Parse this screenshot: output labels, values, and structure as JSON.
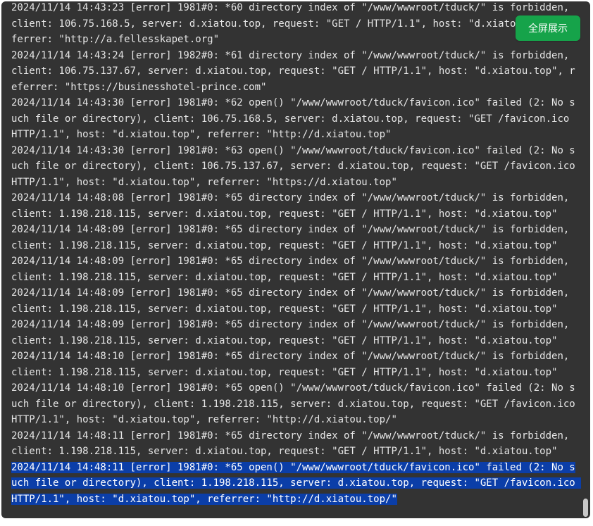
{
  "toolbar": {
    "fullscreen_label": "全屏展示"
  },
  "log": {
    "entries": [
      "2024/11/14 14:43:23 [error] 1981#0: *60 directory index of \"/www/wwwroot/tduck/\" is forbidden, client: 106.75.168.5, server: d.xiatou.top, request: \"GET / HTTP/1.1\", host: \"d.xiatou.top\", referrer: \"http://a.fellesskapet.org\"",
      "2024/11/14 14:43:24 [error] 1982#0: *61 directory index of \"/www/wwwroot/tduck/\" is forbidden, client: 106.75.137.67, server: d.xiatou.top, request: \"GET / HTTP/1.1\", host: \"d.xiatou.top\", referrer: \"https://businesshotel-prince.com\"",
      "2024/11/14 14:43:30 [error] 1981#0: *62 open() \"/www/wwwroot/tduck/favicon.ico\" failed (2: No such file or directory), client: 106.75.168.5, server: d.xiatou.top, request: \"GET /favicon.ico HTTP/1.1\", host: \"d.xiatou.top\", referrer: \"http://d.xiatou.top\"",
      "2024/11/14 14:43:30 [error] 1981#0: *63 open() \"/www/wwwroot/tduck/favicon.ico\" failed (2: No such file or directory), client: 106.75.137.67, server: d.xiatou.top, request: \"GET /favicon.ico HTTP/1.1\", host: \"d.xiatou.top\", referrer: \"https://d.xiatou.top\"",
      "2024/11/14 14:48:08 [error] 1981#0: *65 directory index of \"/www/wwwroot/tduck/\" is forbidden, client: 1.198.218.115, server: d.xiatou.top, request: \"GET / HTTP/1.1\", host: \"d.xiatou.top\"",
      "2024/11/14 14:48:09 [error] 1981#0: *65 directory index of \"/www/wwwroot/tduck/\" is forbidden, client: 1.198.218.115, server: d.xiatou.top, request: \"GET / HTTP/1.1\", host: \"d.xiatou.top\"",
      "2024/11/14 14:48:09 [error] 1981#0: *65 directory index of \"/www/wwwroot/tduck/\" is forbidden, client: 1.198.218.115, server: d.xiatou.top, request: \"GET / HTTP/1.1\", host: \"d.xiatou.top\"",
      "2024/11/14 14:48:09 [error] 1981#0: *65 directory index of \"/www/wwwroot/tduck/\" is forbidden, client: 1.198.218.115, server: d.xiatou.top, request: \"GET / HTTP/1.1\", host: \"d.xiatou.top\"",
      "2024/11/14 14:48:09 [error] 1981#0: *65 directory index of \"/www/wwwroot/tduck/\" is forbidden, client: 1.198.218.115, server: d.xiatou.top, request: \"GET / HTTP/1.1\", host: \"d.xiatou.top\"",
      "2024/11/14 14:48:10 [error] 1981#0: *65 directory index of \"/www/wwwroot/tduck/\" is forbidden, client: 1.198.218.115, server: d.xiatou.top, request: \"GET / HTTP/1.1\", host: \"d.xiatou.top\"",
      "2024/11/14 14:48:10 [error] 1981#0: *65 open() \"/www/wwwroot/tduck/favicon.ico\" failed (2: No such file or directory), client: 1.198.218.115, server: d.xiatou.top, request: \"GET /favicon.ico HTTP/1.1\", host: \"d.xiatou.top\", referrer: \"http://d.xiatou.top/\"",
      "2024/11/14 14:48:11 [error] 1981#0: *65 directory index of \"/www/wwwroot/tduck/\" is forbidden, client: 1.198.218.115, server: d.xiatou.top, request: \"GET / HTTP/1.1\", host: \"d.xiatou.top\"",
      "2024/11/14 14:48:11 [error] 1981#0: *65 open() \"/www/wwwroot/tduck/favicon.ico\" failed (2: No such file or directory), client: 1.198.218.115, server: d.xiatou.top, request: \"GET /favicon.ico HTTP/1.1\", host: \"d.xiatou.top\", referrer: \"http://d.xiatou.top/\""
    ],
    "selected_index": 12
  },
  "colors": {
    "panel_background": "#333333",
    "text": "#e6e6e6",
    "selection": "#0b3ea8",
    "button": "#16a34a"
  }
}
